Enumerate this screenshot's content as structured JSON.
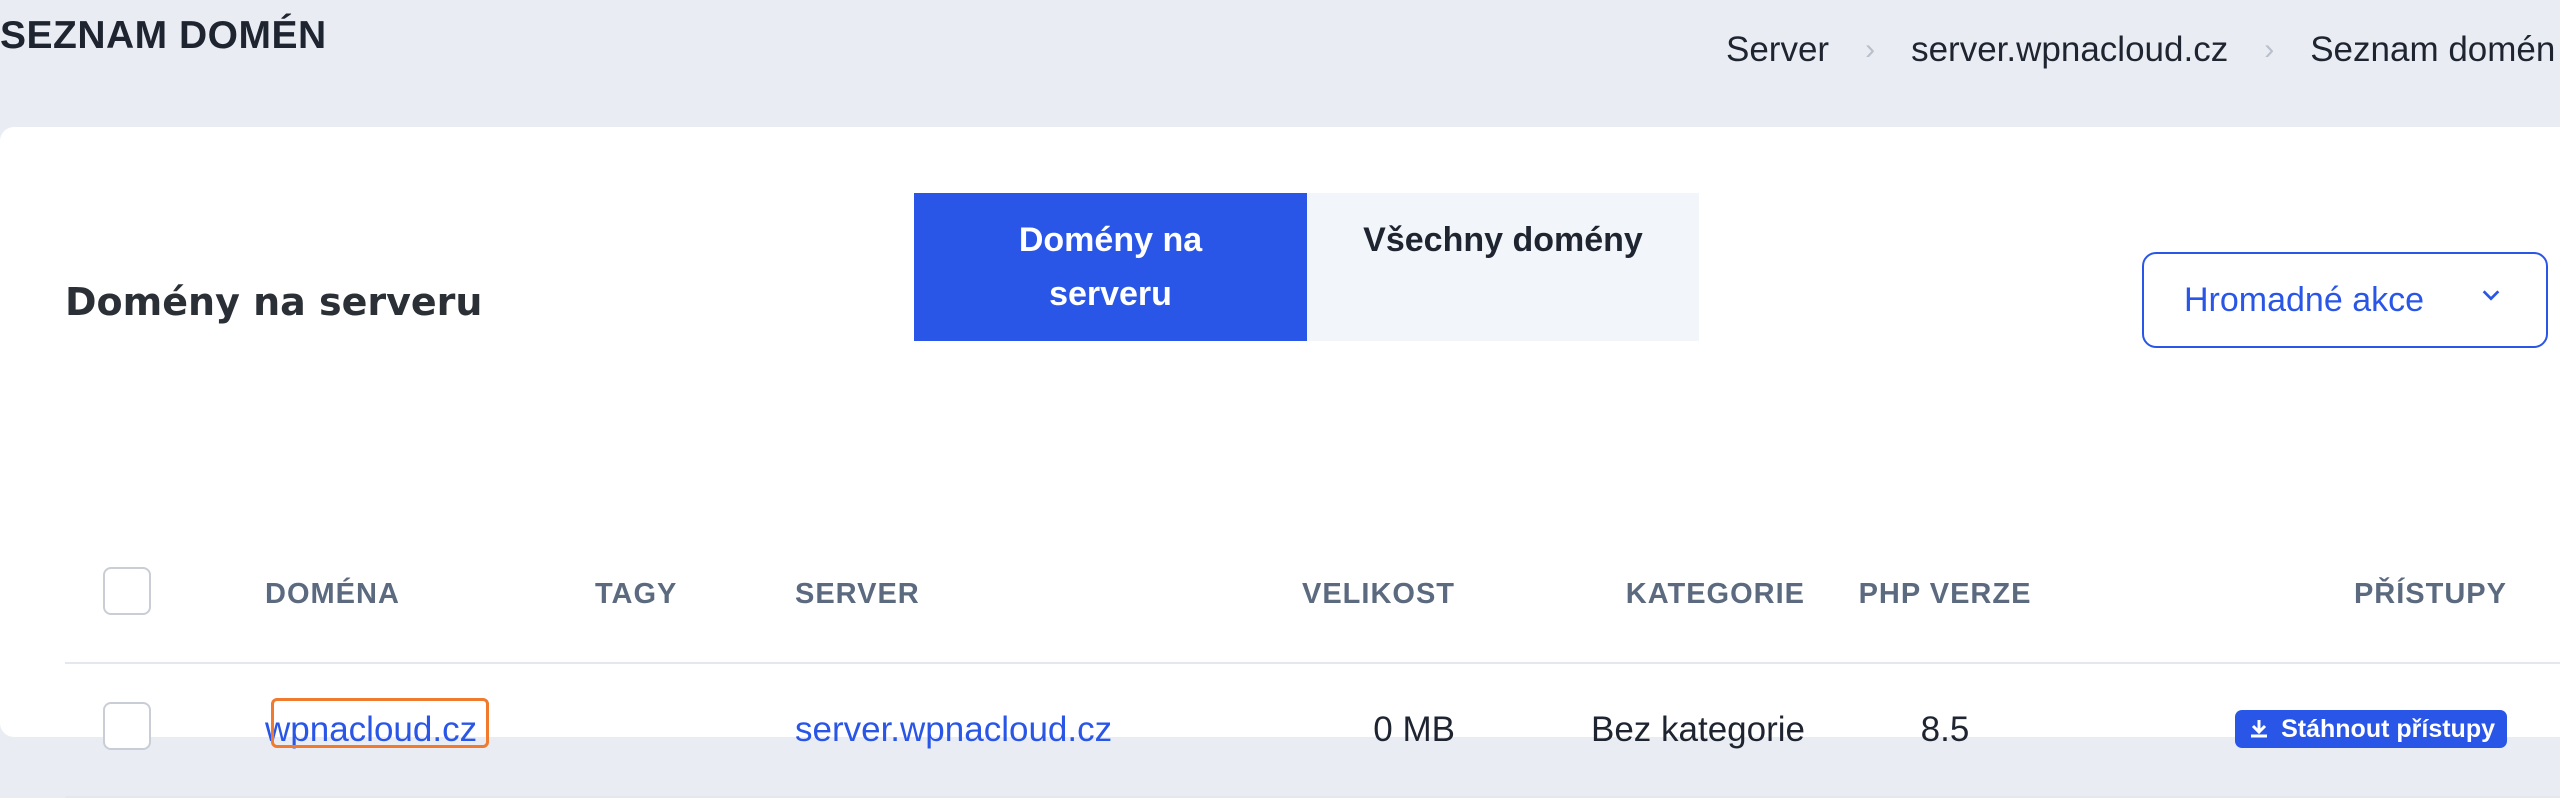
{
  "header": {
    "title": "SEZNAM DOMÉN",
    "breadcrumb": [
      "Server",
      "server.wpnacloud.cz",
      "Seznam domén"
    ]
  },
  "card": {
    "title": "Domény na serveru",
    "tabs": [
      {
        "label": "Domény na serveru",
        "active": true
      },
      {
        "label": "Všechny domény",
        "active": false
      }
    ],
    "bulk_actions": {
      "label": "Hromadné akce",
      "icon": "chevron-down-icon"
    }
  },
  "table": {
    "columns": [
      "DOMÉNA",
      "TAGY",
      "SERVER",
      "VELIKOST",
      "KATEGORIE",
      "PHP VERZE",
      "PŘÍSTUPY"
    ],
    "rows": [
      {
        "domain": "wpnacloud.cz",
        "tags": "",
        "server": "server.wpnacloud.cz",
        "size": "0 MB",
        "category": "Bez kategorie",
        "php": "8.5",
        "access_label": "Stáhnout přístupy",
        "access_icon": "download-icon"
      }
    ]
  },
  "colors": {
    "accent": "#2a56e8",
    "highlight": "#f07a2e",
    "background": "#e9edf3"
  }
}
